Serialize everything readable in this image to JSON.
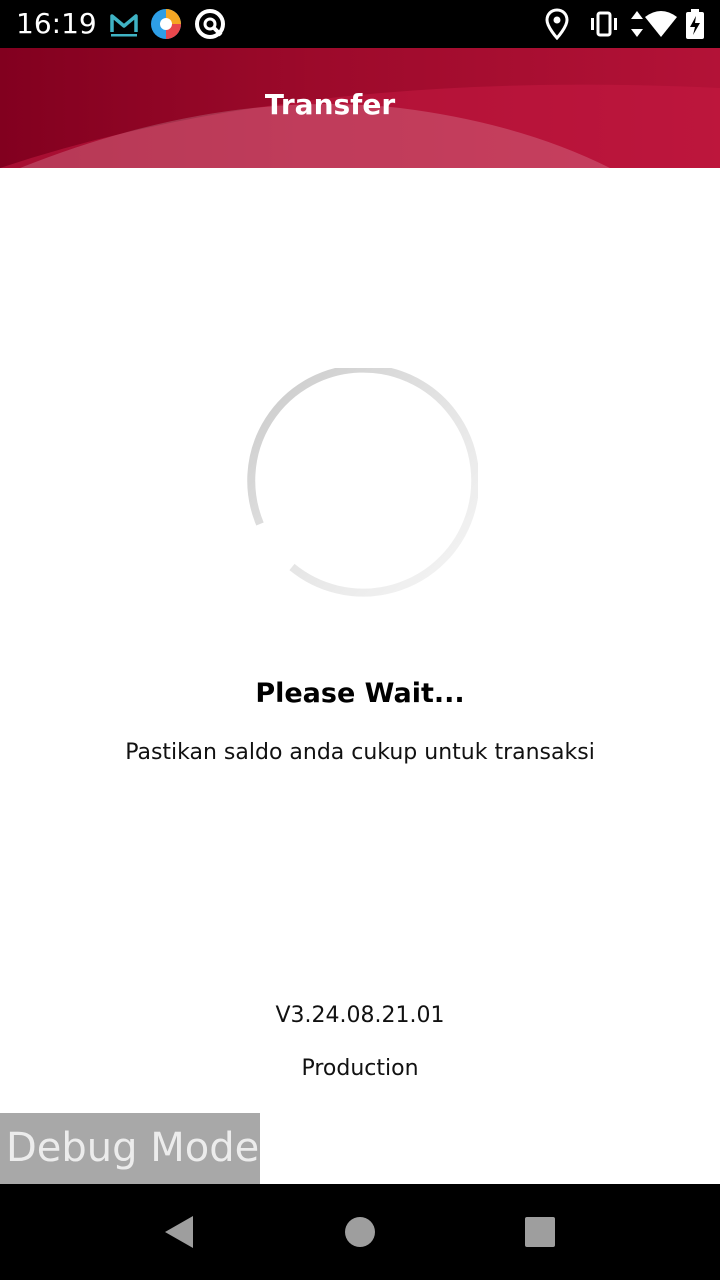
{
  "status_bar": {
    "time": "16:19",
    "icons": [
      "gmail-icon",
      "browser-icon",
      "app-q-icon",
      "location-icon",
      "vibrate-icon",
      "data-arrows-icon",
      "wifi-icon",
      "battery-charging-icon"
    ]
  },
  "header": {
    "title": "Transfer",
    "colors": {
      "primary": "#9d0a2b",
      "dark": "#82001f",
      "light": "#b31237"
    }
  },
  "loading": {
    "spinner_icon": "loading-spinner",
    "title": "Please Wait...",
    "subtitle": "Pastikan saldo anda cukup untuk transaksi"
  },
  "footer": {
    "version": "V3.24.08.21.01",
    "environment": "Production"
  },
  "debug": {
    "label": "Debug Mode"
  },
  "nav_bar": {
    "icons": [
      "back-icon",
      "home-icon",
      "recents-icon"
    ]
  }
}
